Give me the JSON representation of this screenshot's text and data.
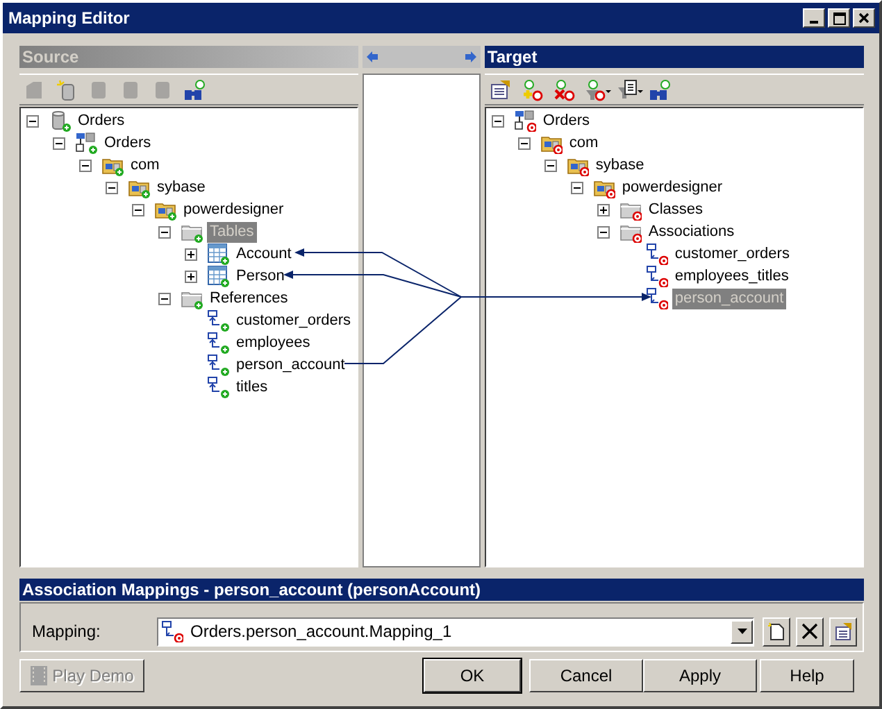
{
  "window": {
    "title": "Mapping Editor"
  },
  "source": {
    "title": "Source",
    "active": false,
    "toolbar": [
      {
        "kind": "doc",
        "disabled": true
      },
      {
        "kind": "newdb",
        "disabled": false
      },
      {
        "kind": "db",
        "disabled": true
      },
      {
        "kind": "db",
        "disabled": true
      },
      {
        "kind": "db",
        "disabled": true
      },
      {
        "kind": "find",
        "disabled": false
      }
    ],
    "tree": [
      {
        "label": "Orders",
        "kind": "database",
        "expanded": true,
        "selected": false,
        "children": [
          {
            "label": "Orders",
            "kind": "model",
            "expanded": true,
            "selected": false,
            "children": [
              {
                "label": "com",
                "kind": "package",
                "expanded": true,
                "selected": false,
                "children": [
                  {
                    "label": "sybase",
                    "kind": "package",
                    "expanded": true,
                    "selected": false,
                    "children": [
                      {
                        "label": "powerdesigner",
                        "kind": "package",
                        "expanded": true,
                        "selected": false,
                        "children": [
                          {
                            "label": "Tables",
                            "kind": "folder",
                            "expanded": true,
                            "selected": true,
                            "children": [
                              {
                                "label": "Account",
                                "kind": "table",
                                "expanded": false,
                                "selected": false
                              },
                              {
                                "label": "Person",
                                "kind": "table",
                                "expanded": false,
                                "selected": false
                              }
                            ]
                          },
                          {
                            "label": "References",
                            "kind": "folder",
                            "expanded": true,
                            "selected": false,
                            "children": [
                              {
                                "label": "customer_orders",
                                "kind": "reference",
                                "selected": false
                              },
                              {
                                "label": "employees",
                                "kind": "reference",
                                "selected": false
                              },
                              {
                                "label": "person_account",
                                "kind": "reference",
                                "selected": false
                              },
                              {
                                "label": "titles",
                                "kind": "reference",
                                "selected": false
                              }
                            ]
                          }
                        ]
                      }
                    ]
                  }
                ]
              }
            ]
          }
        ]
      }
    ]
  },
  "target": {
    "title": "Target",
    "active": true,
    "toolbar": [
      {
        "kind": "props",
        "disabled": false
      },
      {
        "kind": "add",
        "disabled": false
      },
      {
        "kind": "remove",
        "disabled": false
      },
      {
        "kind": "filter",
        "disabled": false
      },
      {
        "kind": "list",
        "disabled": false
      },
      {
        "kind": "find",
        "disabled": false
      }
    ],
    "tree": [
      {
        "label": "Orders",
        "kind": "model",
        "expanded": true,
        "selected": false,
        "children": [
          {
            "label": "com",
            "kind": "package",
            "expanded": true,
            "selected": false,
            "children": [
              {
                "label": "sybase",
                "kind": "package",
                "expanded": true,
                "selected": false,
                "children": [
                  {
                    "label": "powerdesigner",
                    "kind": "package",
                    "expanded": true,
                    "selected": false,
                    "children": [
                      {
                        "label": "Classes",
                        "kind": "folder",
                        "expanded": false,
                        "selected": false
                      },
                      {
                        "label": "Associations",
                        "kind": "folder",
                        "expanded": true,
                        "selected": false,
                        "children": [
                          {
                            "label": "customer_orders",
                            "kind": "association",
                            "selected": false
                          },
                          {
                            "label": "employees_titles",
                            "kind": "association",
                            "selected": false
                          },
                          {
                            "label": "person_account",
                            "kind": "association",
                            "selected": true
                          }
                        ]
                      }
                    ]
                  }
                ]
              }
            ]
          }
        ]
      }
    ]
  },
  "details": {
    "title": "Association Mappings - person_account (personAccount)",
    "field_label": "Mapping:",
    "value": "Orders.person_account.Mapping_1"
  },
  "buttons": [
    {
      "label": "Play Demo",
      "disabled": true,
      "default": false
    },
    {
      "label": "OK",
      "disabled": false,
      "default": true
    },
    {
      "label": "Cancel",
      "disabled": false,
      "default": false
    },
    {
      "label": "Apply",
      "disabled": false,
      "default": false
    },
    {
      "label": "Help",
      "disabled": false,
      "default": false
    }
  ]
}
